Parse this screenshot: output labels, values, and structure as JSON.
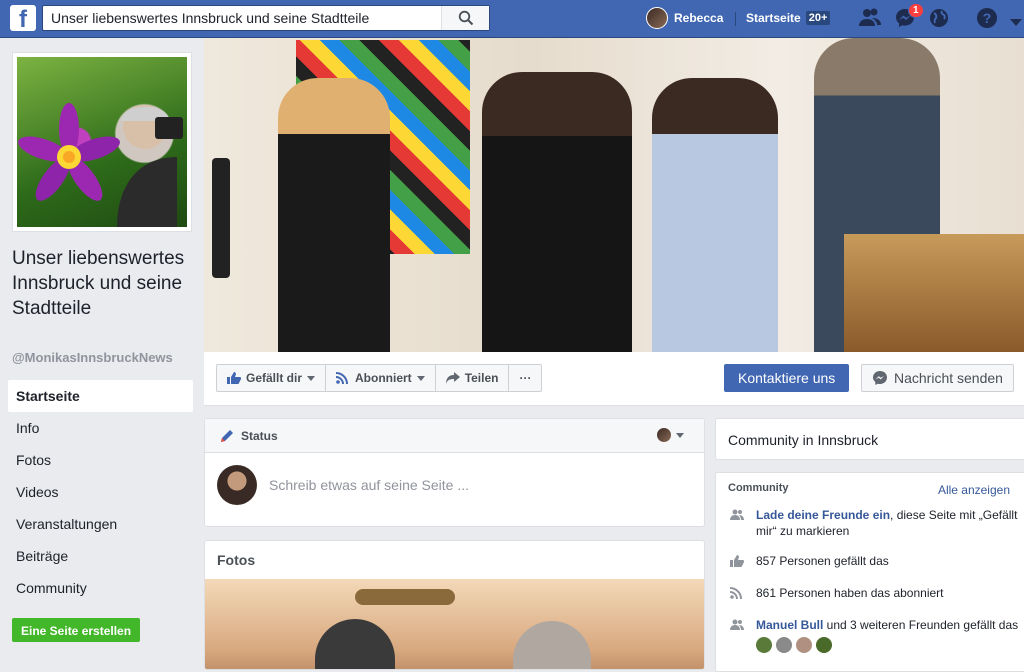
{
  "topbar": {
    "logo": "f",
    "search_value": "Unser liebenswertes Innsbruck und seine Stadtteile",
    "user_name": "Rebecca",
    "home_label": "Startseite",
    "home_count": "20+",
    "messenger_badge": "1"
  },
  "page": {
    "name": "Unser liebenswertes Innsbruck und seine Stadtteile",
    "handle": "@MonikasInnsbruckNews"
  },
  "nav": {
    "items": [
      {
        "label": "Startseite"
      },
      {
        "label": "Info"
      },
      {
        "label": "Fotos"
      },
      {
        "label": "Videos"
      },
      {
        "label": "Veranstaltungen"
      },
      {
        "label": "Beiträge"
      },
      {
        "label": "Community"
      }
    ],
    "create_page": "Eine Seite erstellen"
  },
  "actions": {
    "like": "Gefällt dir",
    "follow": "Abonniert",
    "share": "Teilen",
    "more": "···",
    "contact": "Kontaktiere uns",
    "message": "Nachricht senden"
  },
  "status": {
    "title": "Status",
    "placeholder": "Schreib etwas auf seine Seite ..."
  },
  "photos": {
    "title": "Fotos"
  },
  "community": {
    "location_title": "Community in Innsbruck",
    "header": "Community",
    "see_all": "Alle anzeigen",
    "invite_link": "Lade deine Freunde ein",
    "invite_text": ", diese Seite mit „Gefällt mir“ zu markieren",
    "likes": "857 Personen gefällt das",
    "follows": "861 Personen haben das abonniert",
    "friend_name": "Manuel Bull",
    "friends_text": " und 3 weiteren Freunden gefällt das"
  },
  "colors": {
    "brand": "#4267b2",
    "create_button": "#42b72a",
    "notification": "#fa3e3e"
  },
  "icons": [
    "search-icon",
    "friends-icon",
    "messenger-icon",
    "globe-icon",
    "help-icon",
    "dropdown-icon",
    "thumbs-up-icon",
    "rss-icon",
    "share-icon",
    "pencil-icon",
    "messenger-small-icon"
  ]
}
